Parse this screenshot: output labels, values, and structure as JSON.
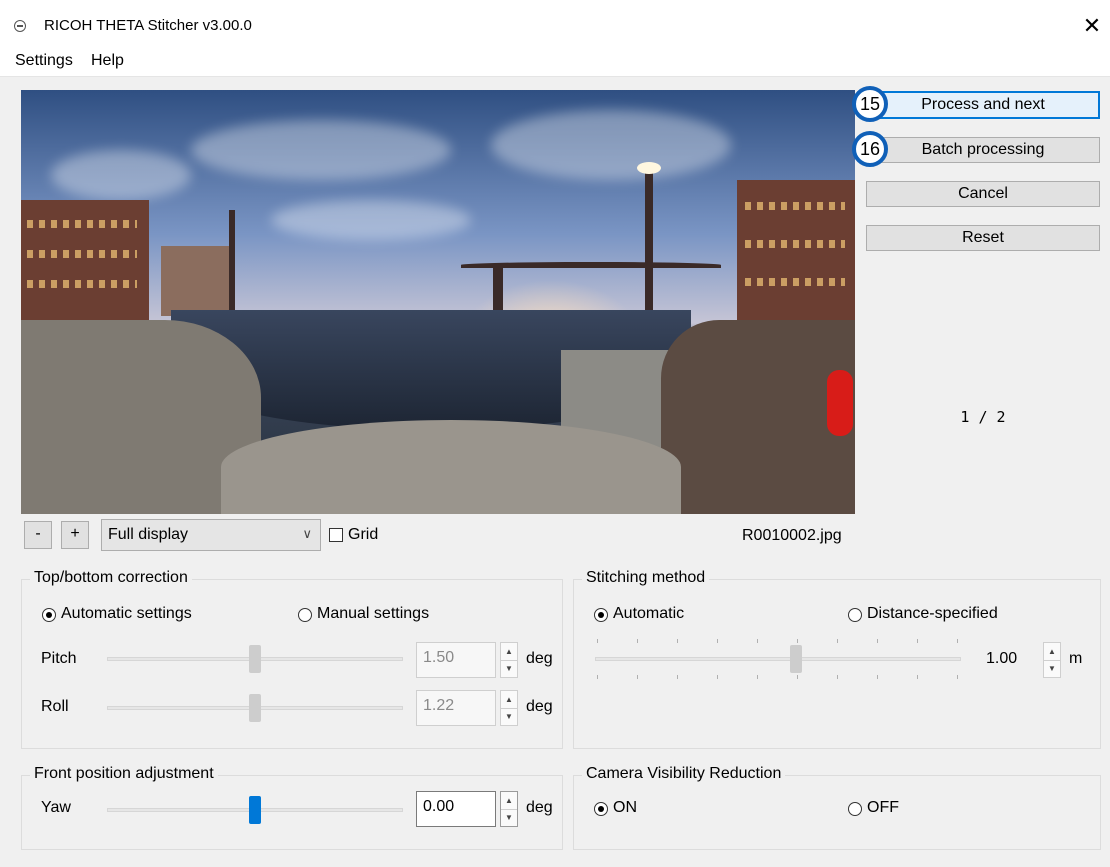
{
  "window": {
    "title": "RICOH THETA Stitcher v3.00.0",
    "close_glyph": "✕"
  },
  "menu": {
    "items": [
      "Settings",
      "Help"
    ]
  },
  "actions": {
    "process_next": {
      "label": "Process and next",
      "badge": "15"
    },
    "batch": {
      "label": "Batch processing",
      "badge": "16"
    },
    "cancel": {
      "label": "Cancel"
    },
    "reset": {
      "label": "Reset"
    }
  },
  "counter": "1 / 2",
  "toolbar": {
    "zoom_out": "-",
    "zoom_in": "+",
    "display_mode": "Full display",
    "grid_label": "Grid",
    "grid_checked": false,
    "filename": "R0010002.jpg"
  },
  "top_bottom": {
    "title": "Top/bottom correction",
    "auto_label": "Automatic settings",
    "manual_label": "Manual settings",
    "selected": "auto",
    "pitch": {
      "label": "Pitch",
      "value": "1.50",
      "unit": "deg",
      "level": 0.5
    },
    "roll": {
      "label": "Roll",
      "value": "1.22",
      "unit": "deg",
      "level": 0.5
    }
  },
  "stitching": {
    "title": "Stitching method",
    "auto_label": "Automatic",
    "distance_label": "Distance-specified",
    "selected": "auto",
    "distance": {
      "value": "1.00",
      "unit": "m",
      "level": 0.55
    }
  },
  "front": {
    "title": "Front position adjustment",
    "yaw": {
      "label": "Yaw",
      "value": "0.00",
      "unit": "deg",
      "level": 0.5
    }
  },
  "camera_visibility": {
    "title": "Camera Visibility Reduction",
    "on_label": "ON",
    "off_label": "OFF",
    "selected": "on"
  },
  "icons": {
    "app": "app-circle-icon",
    "close": "close-icon",
    "chevron": "chevron-down-icon"
  },
  "colors": {
    "accent": "#0078d7",
    "badge_ring": "#1060b8"
  }
}
